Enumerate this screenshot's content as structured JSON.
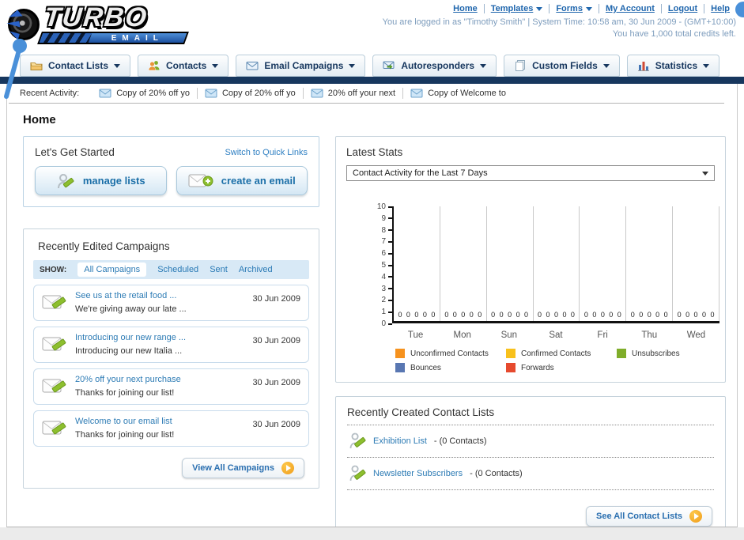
{
  "header": {
    "nav_links": [
      {
        "label": "Home"
      },
      {
        "label": "Templates"
      },
      {
        "label": "Forms"
      },
      {
        "label": "My Account"
      },
      {
        "label": "Logout"
      },
      {
        "label": "Help"
      }
    ],
    "login_info": "You are logged in as \"Timothy Smith\" | System Time: 10:58 am, 30 Jun 2009 - (GMT+10:00)",
    "credits_info": "You have 1,000 total credits left.",
    "logo_title": "TURBO",
    "logo_subtitle": "EMAIL"
  },
  "nav_tabs": [
    {
      "label": "Contact Lists"
    },
    {
      "label": "Contacts"
    },
    {
      "label": "Email Campaigns"
    },
    {
      "label": "Autoresponders"
    },
    {
      "label": "Custom Fields"
    },
    {
      "label": "Statistics"
    }
  ],
  "recent_activity": {
    "label": "Recent Activity:",
    "items": [
      {
        "text": "Copy of 20% off yo"
      },
      {
        "text": "Copy of 20% off yo"
      },
      {
        "text": "20% off your next"
      },
      {
        "text": "Copy of Welcome to"
      }
    ]
  },
  "page_title": "Home",
  "get_started": {
    "title": "Let's Get Started",
    "switch_link": "Switch to Quick Links",
    "manage_lists_label": "manage lists",
    "create_email_label": "create an email"
  },
  "campaigns": {
    "title": "Recently Edited Campaigns",
    "show_label": "SHOW:",
    "filters": [
      {
        "label": "All Campaigns",
        "active": true
      },
      {
        "label": "Scheduled",
        "active": false
      },
      {
        "label": "Sent",
        "active": false
      },
      {
        "label": "Archived",
        "active": false
      }
    ],
    "items": [
      {
        "title": "See us at the retail food ...",
        "subtitle": "We're giving away our late ...",
        "date": "30 Jun 2009"
      },
      {
        "title": "Introducing our new range ...",
        "subtitle": "Introducing our new Italia ...",
        "date": "30 Jun 2009"
      },
      {
        "title": "20% off your next purchase",
        "subtitle": "Thanks for joining our list!",
        "date": "30 Jun 2009"
      },
      {
        "title": "Welcome to our email list",
        "subtitle": "Thanks for joining our list!",
        "date": "30 Jun 2009"
      }
    ],
    "view_all_label": "View All Campaigns"
  },
  "latest_stats": {
    "title": "Latest Stats",
    "selected_report": "Contact Activity for the Last 7 Days"
  },
  "chart_data": {
    "type": "bar",
    "title": "Contact Activity for the Last 7 Days",
    "categories": [
      "Tue",
      "Mon",
      "Sun",
      "Sat",
      "Fri",
      "Thu",
      "Wed"
    ],
    "series": [
      {
        "name": "Unconfirmed Contacts",
        "color": "#f6921e",
        "values": [
          0,
          0,
          0,
          0,
          0,
          0,
          0
        ]
      },
      {
        "name": "Confirmed Contacts",
        "color": "#f8c11c",
        "values": [
          0,
          0,
          0,
          0,
          0,
          0,
          0
        ]
      },
      {
        "name": "Unsubscribes",
        "color": "#7fad2a",
        "values": [
          0,
          0,
          0,
          0,
          0,
          0,
          0
        ]
      },
      {
        "name": "Bounces",
        "color": "#5977b2",
        "values": [
          0,
          0,
          0,
          0,
          0,
          0,
          0
        ]
      },
      {
        "name": "Forwards",
        "color": "#e64a2e",
        "values": [
          0,
          0,
          0,
          0,
          0,
          0,
          0
        ]
      }
    ],
    "ylim": [
      0,
      10
    ],
    "ytick_step": 1,
    "grid": "vertical-only",
    "legend_position": "bottom-left",
    "value_labels_shown": true
  },
  "contact_lists": {
    "title": "Recently Created Contact Lists",
    "items": [
      {
        "name": "Exhibition List",
        "count": "- (0 Contacts)"
      },
      {
        "name": "Newsletter Subscribers",
        "count": "- (0 Contacts)"
      }
    ],
    "see_all_label": "See All Contact Lists"
  },
  "colors": {
    "navy_bar": "#17375e",
    "link_blue": "#1f66ad",
    "panel_link": "#2e7cb5",
    "login_text": "#7e9dbd",
    "button_text": "#1b6fa8",
    "orange_arrow": "#ef9c1b",
    "annotation_blue": "#4a90d9"
  }
}
